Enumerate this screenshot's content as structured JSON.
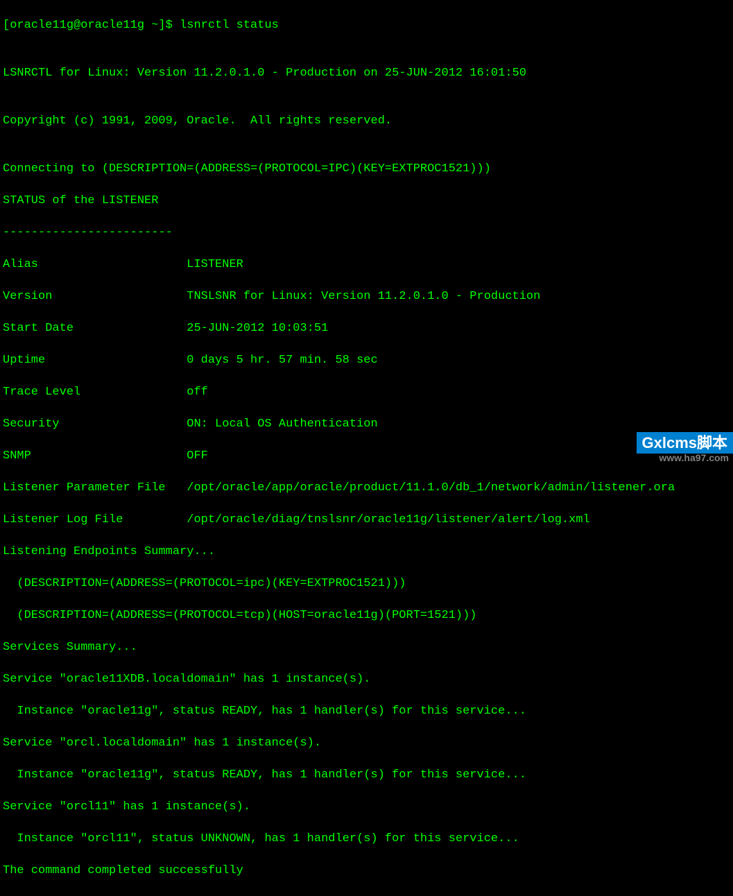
{
  "prompt": "[oracle11g@oracle11g ~]$ lsnrctl status",
  "blank1": "",
  "header": "LSNRCTL for Linux: Version 11.2.0.1.0 - Production on 25-JUN-2012 16:01:50",
  "blank2": "",
  "copyright": "Copyright (c) 1991, 2009, Oracle.  All rights reserved.",
  "blank3": "",
  "connecting": "Connecting to (DESCRIPTION=(ADDRESS=(PROTOCOL=IPC)(KEY=EXTPROC1521)))",
  "status_header": "STATUS of the LISTENER",
  "divider": "------------------------",
  "alias": "Alias                     LISTENER",
  "version": "Version                   TNSLSNR for Linux: Version 11.2.0.1.0 - Production",
  "start_date": "Start Date                25-JUN-2012 10:03:51",
  "uptime": "Uptime                    0 days 5 hr. 57 min. 58 sec",
  "trace_level": "Trace Level               off",
  "security": "Security                  ON: Local OS Authentication",
  "snmp": "SNMP                      OFF",
  "param_file": "Listener Parameter File   /opt/oracle/app/oracle/product/11.1.0/db_1/network/admin/listener.ora",
  "log_file": "Listener Log File         /opt/oracle/diag/tnslsnr/oracle11g/listener/alert/log.xml",
  "endpoints_header": "Listening Endpoints Summary...",
  "endpoint1": "  (DESCRIPTION=(ADDRESS=(PROTOCOL=ipc)(KEY=EXTPROC1521)))",
  "endpoint2": "  (DESCRIPTION=(ADDRESS=(PROTOCOL=tcp)(HOST=oracle11g)(PORT=1521)))",
  "services_header": "Services Summary...",
  "service1": "Service \"oracle11XDB.localdomain\" has 1 instance(s).",
  "instance1": "  Instance \"oracle11g\", status READY, has 1 handler(s) for this service...",
  "service2": "Service \"orcl.localdomain\" has 1 instance(s).",
  "instance2": "  Instance \"oracle11g\", status READY, has 1 handler(s) for this service...",
  "service3": "Service \"orcl11\" has 1 instance(s).",
  "instance3": "  Instance \"orcl11\", status UNKNOWN, has 1 handler(s) for this service...",
  "completed": "The command completed successfully",
  "watermark_logo": "Gxlcms脚本",
  "watermark_url": "www.ha97.com"
}
